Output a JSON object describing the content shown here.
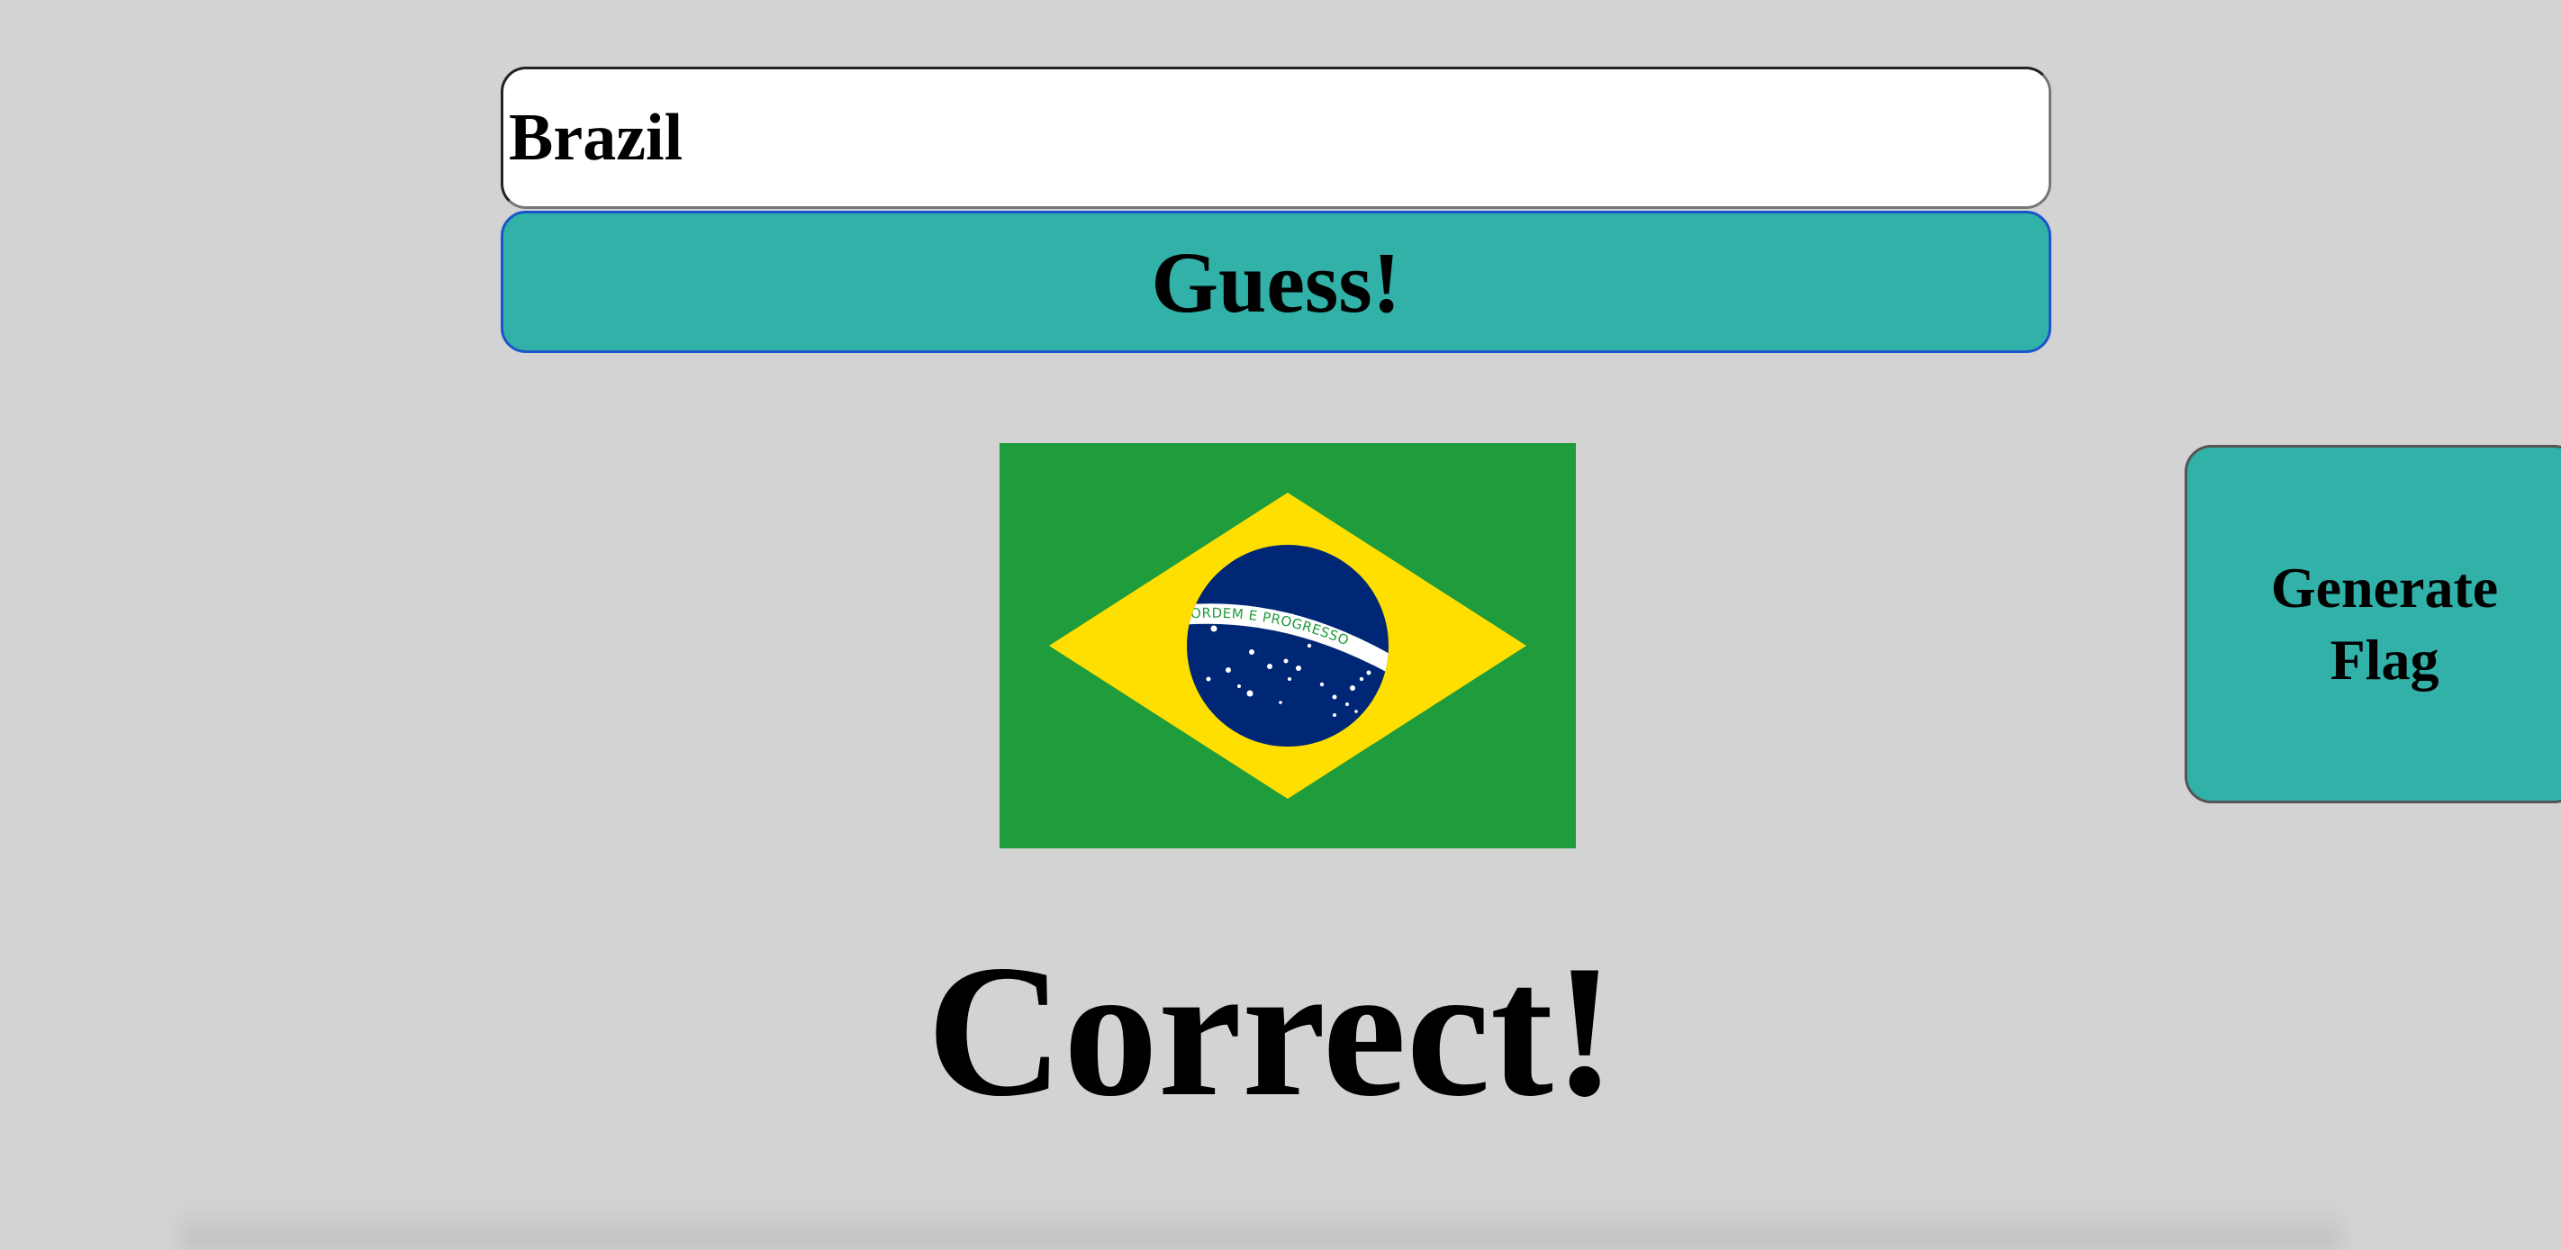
{
  "guess": {
    "input_value": "Brazil",
    "button_label": "Guess!"
  },
  "flag": {
    "country": "Brazil",
    "motto": "ORDEM E PROGRESSO",
    "colors": {
      "green": "#1f9c3b",
      "yellow": "#fedf00",
      "blue": "#002776",
      "white": "#ffffff"
    }
  },
  "generate": {
    "label": "Generate Flag"
  },
  "result": {
    "message": "Correct!"
  },
  "theme": {
    "background": "#d3d3d3",
    "button_teal": "#31b1a8",
    "focus_border": "#1a56c9"
  }
}
